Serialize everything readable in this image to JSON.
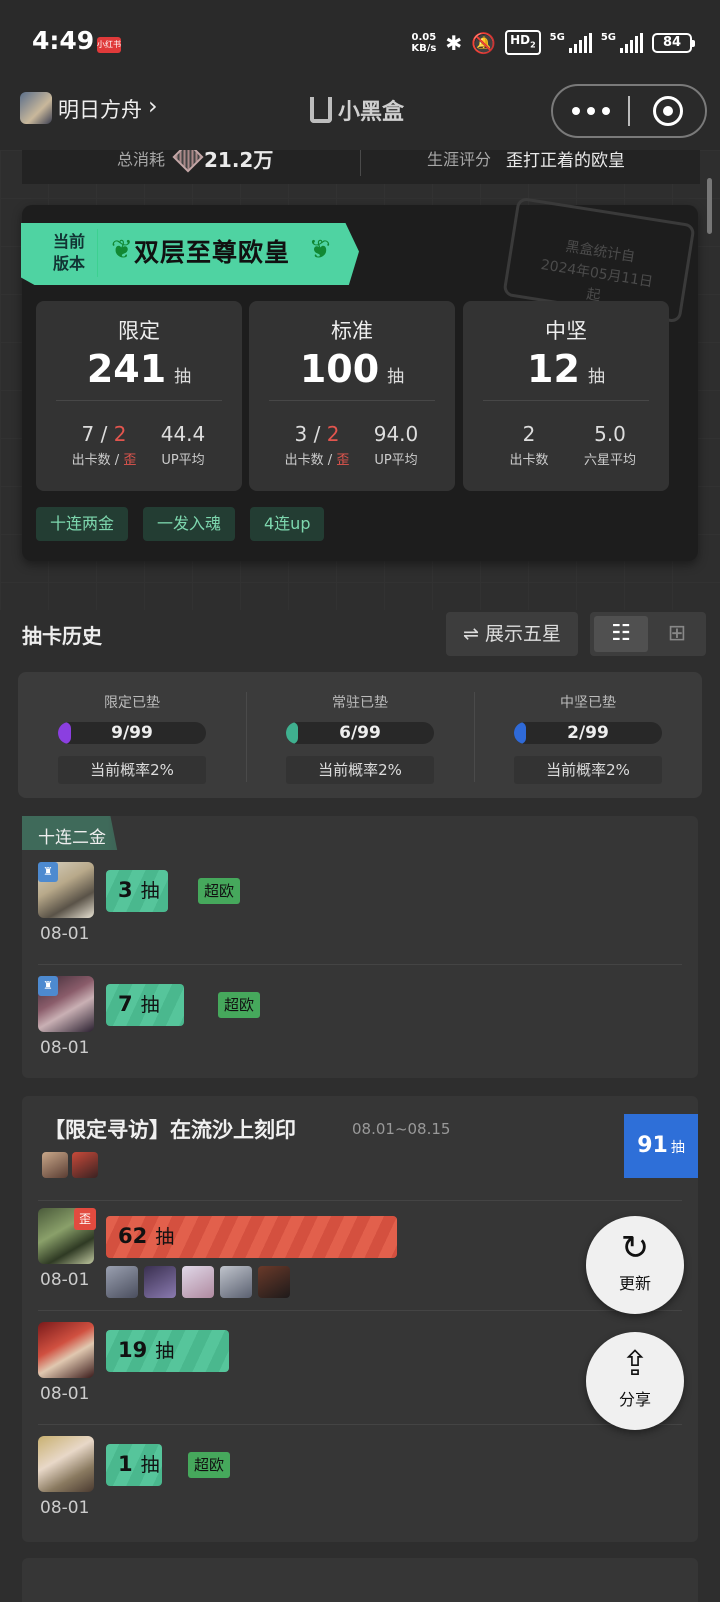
{
  "status": {
    "time": "4:49",
    "notif_badge": "小红书",
    "net_speed_value": "0.05",
    "net_speed_unit": "KB/s",
    "hd": "HD",
    "hd_sub": "2",
    "sim1": "5G",
    "sim2": "5G",
    "battery": "84"
  },
  "nav": {
    "app_name": "明日方舟",
    "chevron": "›",
    "brand": "小黑盒"
  },
  "summary": {
    "total_label": "总消耗",
    "total_value": "21.2万",
    "career_label": "生涯评分",
    "career_value": "歪打正着的欧皇"
  },
  "card": {
    "version_line1": "当前",
    "version_line2": "版本",
    "rank_title": "双层至尊欧皇",
    "stamp_line1": "黑盒统计自",
    "stamp_line2": "2024年05月11日",
    "stamp_line3": "起",
    "pools": [
      {
        "title": "限定",
        "count": "241",
        "unit": "抽",
        "stat1_main": "7 / ",
        "stat1_red": "2",
        "stat1_label": "出卡数 / ",
        "stat1_label_red": "歪",
        "stat2_value": "44.4",
        "stat2_label": "UP平均"
      },
      {
        "title": "标准",
        "count": "100",
        "unit": "抽",
        "stat1_main": "3 / ",
        "stat1_red": "2",
        "stat1_label": "出卡数 / ",
        "stat1_label_red": "歪",
        "stat2_value": "94.0",
        "stat2_label": "UP平均"
      },
      {
        "title": "中坚",
        "count": "12",
        "unit": "抽",
        "stat1_main": "2",
        "stat1_red": "",
        "stat1_label": "出卡数",
        "stat1_label_red": "",
        "stat2_value": "5.0",
        "stat2_label": "六星平均"
      }
    ],
    "tags": [
      "十连两金",
      "一发入魂",
      "4连up"
    ]
  },
  "history": {
    "title": "抽卡历史",
    "show_five": "⇌ 展示五星"
  },
  "pity": [
    {
      "label": "限定已垫",
      "current": 9,
      "max": 99,
      "text": "9/99",
      "rate": "当前概率2%",
      "color": "#8b3fe0"
    },
    {
      "label": "常驻已垫",
      "current": 6,
      "max": 99,
      "text": "6/99",
      "rate": "当前概率2%",
      "color": "#3fb08f"
    },
    {
      "label": "中坚已垫",
      "current": 2,
      "max": 99,
      "text": "2/99",
      "rate": "当前概率2%",
      "color": "#2f6ad8"
    }
  ],
  "group1": {
    "tag": "十连二金",
    "rows": [
      {
        "pulls": "3",
        "unit": "抽",
        "badge": "超欧",
        "date": "08-01",
        "fill": 0.11
      },
      {
        "pulls": "7",
        "unit": "抽",
        "badge": "超欧",
        "date": "08-01",
        "fill": 0.14
      }
    ]
  },
  "banner": {
    "title": "【限定寻访】在流沙上刻印",
    "range": "08.01~08.15",
    "total": "91",
    "total_unit": "抽",
    "rows": [
      {
        "pulls": "62",
        "unit": "抽",
        "date": "08-01",
        "wai": "歪",
        "fill": 0.52
      },
      {
        "pulls": "19",
        "unit": "抽",
        "date": "08-01",
        "fill": 0.22
      },
      {
        "pulls": "1",
        "unit": "抽",
        "date": "08-01",
        "badge": "超欧",
        "fill": 0.1
      }
    ]
  },
  "fabs": {
    "refresh": "更新",
    "share": "分享"
  }
}
